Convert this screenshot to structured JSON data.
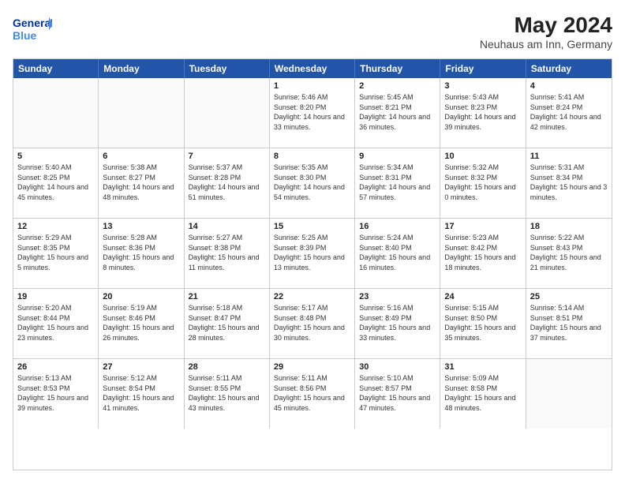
{
  "header": {
    "logo_text_general": "General",
    "logo_text_blue": "Blue",
    "main_title": "May 2024",
    "subtitle": "Neuhaus am Inn, Germany"
  },
  "calendar": {
    "days_of_week": [
      "Sunday",
      "Monday",
      "Tuesday",
      "Wednesday",
      "Thursday",
      "Friday",
      "Saturday"
    ],
    "weeks": [
      [
        {
          "day": "",
          "sunrise": "",
          "sunset": "",
          "daylight": "",
          "empty": true
        },
        {
          "day": "",
          "sunrise": "",
          "sunset": "",
          "daylight": "",
          "empty": true
        },
        {
          "day": "",
          "sunrise": "",
          "sunset": "",
          "daylight": "",
          "empty": true
        },
        {
          "day": "1",
          "sunrise": "Sunrise: 5:46 AM",
          "sunset": "Sunset: 8:20 PM",
          "daylight": "Daylight: 14 hours and 33 minutes.",
          "empty": false
        },
        {
          "day": "2",
          "sunrise": "Sunrise: 5:45 AM",
          "sunset": "Sunset: 8:21 PM",
          "daylight": "Daylight: 14 hours and 36 minutes.",
          "empty": false
        },
        {
          "day": "3",
          "sunrise": "Sunrise: 5:43 AM",
          "sunset": "Sunset: 8:23 PM",
          "daylight": "Daylight: 14 hours and 39 minutes.",
          "empty": false
        },
        {
          "day": "4",
          "sunrise": "Sunrise: 5:41 AM",
          "sunset": "Sunset: 8:24 PM",
          "daylight": "Daylight: 14 hours and 42 minutes.",
          "empty": false
        }
      ],
      [
        {
          "day": "5",
          "sunrise": "Sunrise: 5:40 AM",
          "sunset": "Sunset: 8:25 PM",
          "daylight": "Daylight: 14 hours and 45 minutes.",
          "empty": false
        },
        {
          "day": "6",
          "sunrise": "Sunrise: 5:38 AM",
          "sunset": "Sunset: 8:27 PM",
          "daylight": "Daylight: 14 hours and 48 minutes.",
          "empty": false
        },
        {
          "day": "7",
          "sunrise": "Sunrise: 5:37 AM",
          "sunset": "Sunset: 8:28 PM",
          "daylight": "Daylight: 14 hours and 51 minutes.",
          "empty": false
        },
        {
          "day": "8",
          "sunrise": "Sunrise: 5:35 AM",
          "sunset": "Sunset: 8:30 PM",
          "daylight": "Daylight: 14 hours and 54 minutes.",
          "empty": false
        },
        {
          "day": "9",
          "sunrise": "Sunrise: 5:34 AM",
          "sunset": "Sunset: 8:31 PM",
          "daylight": "Daylight: 14 hours and 57 minutes.",
          "empty": false
        },
        {
          "day": "10",
          "sunrise": "Sunrise: 5:32 AM",
          "sunset": "Sunset: 8:32 PM",
          "daylight": "Daylight: 15 hours and 0 minutes.",
          "empty": false
        },
        {
          "day": "11",
          "sunrise": "Sunrise: 5:31 AM",
          "sunset": "Sunset: 8:34 PM",
          "daylight": "Daylight: 15 hours and 3 minutes.",
          "empty": false
        }
      ],
      [
        {
          "day": "12",
          "sunrise": "Sunrise: 5:29 AM",
          "sunset": "Sunset: 8:35 PM",
          "daylight": "Daylight: 15 hours and 5 minutes.",
          "empty": false
        },
        {
          "day": "13",
          "sunrise": "Sunrise: 5:28 AM",
          "sunset": "Sunset: 8:36 PM",
          "daylight": "Daylight: 15 hours and 8 minutes.",
          "empty": false
        },
        {
          "day": "14",
          "sunrise": "Sunrise: 5:27 AM",
          "sunset": "Sunset: 8:38 PM",
          "daylight": "Daylight: 15 hours and 11 minutes.",
          "empty": false
        },
        {
          "day": "15",
          "sunrise": "Sunrise: 5:25 AM",
          "sunset": "Sunset: 8:39 PM",
          "daylight": "Daylight: 15 hours and 13 minutes.",
          "empty": false
        },
        {
          "day": "16",
          "sunrise": "Sunrise: 5:24 AM",
          "sunset": "Sunset: 8:40 PM",
          "daylight": "Daylight: 15 hours and 16 minutes.",
          "empty": false
        },
        {
          "day": "17",
          "sunrise": "Sunrise: 5:23 AM",
          "sunset": "Sunset: 8:42 PM",
          "daylight": "Daylight: 15 hours and 18 minutes.",
          "empty": false
        },
        {
          "day": "18",
          "sunrise": "Sunrise: 5:22 AM",
          "sunset": "Sunset: 8:43 PM",
          "daylight": "Daylight: 15 hours and 21 minutes.",
          "empty": false
        }
      ],
      [
        {
          "day": "19",
          "sunrise": "Sunrise: 5:20 AM",
          "sunset": "Sunset: 8:44 PM",
          "daylight": "Daylight: 15 hours and 23 minutes.",
          "empty": false
        },
        {
          "day": "20",
          "sunrise": "Sunrise: 5:19 AM",
          "sunset": "Sunset: 8:46 PM",
          "daylight": "Daylight: 15 hours and 26 minutes.",
          "empty": false
        },
        {
          "day": "21",
          "sunrise": "Sunrise: 5:18 AM",
          "sunset": "Sunset: 8:47 PM",
          "daylight": "Daylight: 15 hours and 28 minutes.",
          "empty": false
        },
        {
          "day": "22",
          "sunrise": "Sunrise: 5:17 AM",
          "sunset": "Sunset: 8:48 PM",
          "daylight": "Daylight: 15 hours and 30 minutes.",
          "empty": false
        },
        {
          "day": "23",
          "sunrise": "Sunrise: 5:16 AM",
          "sunset": "Sunset: 8:49 PM",
          "daylight": "Daylight: 15 hours and 33 minutes.",
          "empty": false
        },
        {
          "day": "24",
          "sunrise": "Sunrise: 5:15 AM",
          "sunset": "Sunset: 8:50 PM",
          "daylight": "Daylight: 15 hours and 35 minutes.",
          "empty": false
        },
        {
          "day": "25",
          "sunrise": "Sunrise: 5:14 AM",
          "sunset": "Sunset: 8:51 PM",
          "daylight": "Daylight: 15 hours and 37 minutes.",
          "empty": false
        }
      ],
      [
        {
          "day": "26",
          "sunrise": "Sunrise: 5:13 AM",
          "sunset": "Sunset: 8:53 PM",
          "daylight": "Daylight: 15 hours and 39 minutes.",
          "empty": false
        },
        {
          "day": "27",
          "sunrise": "Sunrise: 5:12 AM",
          "sunset": "Sunset: 8:54 PM",
          "daylight": "Daylight: 15 hours and 41 minutes.",
          "empty": false
        },
        {
          "day": "28",
          "sunrise": "Sunrise: 5:11 AM",
          "sunset": "Sunset: 8:55 PM",
          "daylight": "Daylight: 15 hours and 43 minutes.",
          "empty": false
        },
        {
          "day": "29",
          "sunrise": "Sunrise: 5:11 AM",
          "sunset": "Sunset: 8:56 PM",
          "daylight": "Daylight: 15 hours and 45 minutes.",
          "empty": false
        },
        {
          "day": "30",
          "sunrise": "Sunrise: 5:10 AM",
          "sunset": "Sunset: 8:57 PM",
          "daylight": "Daylight: 15 hours and 47 minutes.",
          "empty": false
        },
        {
          "day": "31",
          "sunrise": "Sunrise: 5:09 AM",
          "sunset": "Sunset: 8:58 PM",
          "daylight": "Daylight: 15 hours and 48 minutes.",
          "empty": false
        },
        {
          "day": "",
          "sunrise": "",
          "sunset": "",
          "daylight": "",
          "empty": true
        }
      ]
    ]
  }
}
